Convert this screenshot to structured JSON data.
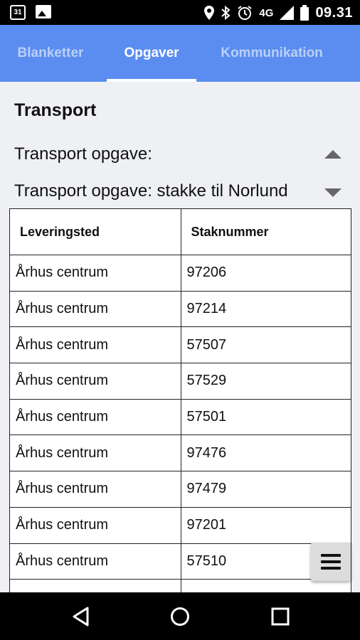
{
  "status_bar": {
    "calendar_day": "31",
    "network": "4G",
    "time": "09.31"
  },
  "tabs": [
    {
      "label": "Blanketter"
    },
    {
      "label": "Opgaver"
    },
    {
      "label": "Kommunikation"
    }
  ],
  "section": {
    "title": "Transport",
    "task_header": "Transport opgave:",
    "task_subheader": "Transport opgave: stakke til Norlund"
  },
  "table": {
    "columns": [
      "Leveringsted",
      "Staknummer"
    ],
    "rows": [
      [
        "Århus centrum",
        "97206"
      ],
      [
        "Århus centrum",
        "97214"
      ],
      [
        "Århus centrum",
        "57507"
      ],
      [
        "Århus centrum",
        "57529"
      ],
      [
        "Århus centrum",
        "57501"
      ],
      [
        "Århus centrum",
        "97476"
      ],
      [
        "Århus centrum",
        "97479"
      ],
      [
        "Århus centrum",
        "97201"
      ],
      [
        "Århus centrum",
        "57510"
      ]
    ]
  },
  "colors": {
    "tab_bar": "#5a8def",
    "background": "#eef0f4"
  },
  "icons": {
    "calendar": "calendar-icon",
    "image": "image-icon",
    "location": "location-icon",
    "bluetooth": "bluetooth-icon",
    "alarm": "alarm-icon",
    "signal": "signal-icon",
    "battery": "battery-icon",
    "expand": "triangle-up-icon",
    "collapse": "triangle-down-icon",
    "menu": "hamburger-menu-icon",
    "back": "back-icon",
    "home": "home-icon",
    "recents": "recents-icon"
  }
}
